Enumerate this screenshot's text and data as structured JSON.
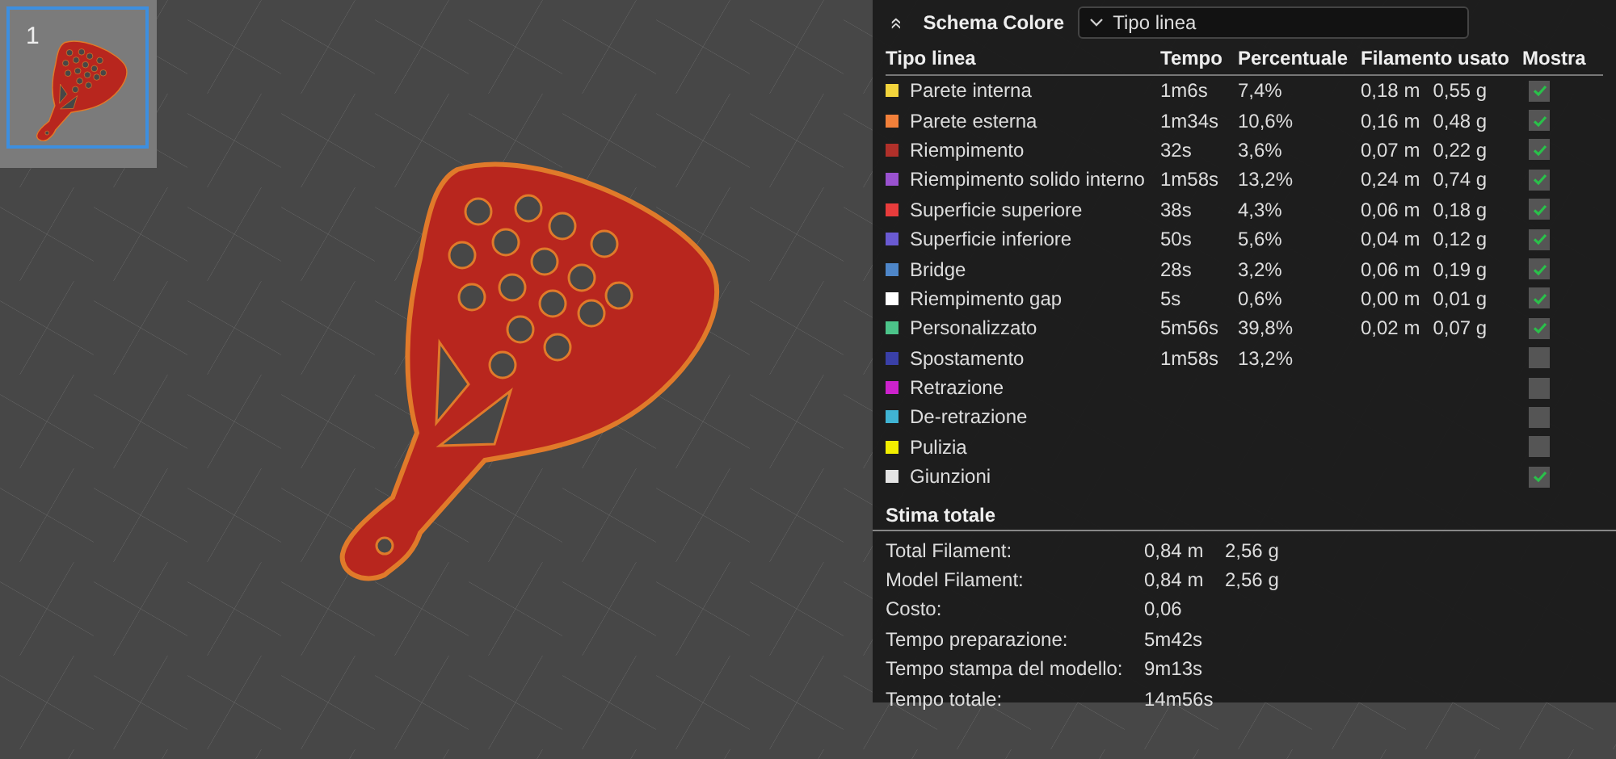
{
  "plates": [
    {
      "number": "1",
      "selected": true
    }
  ],
  "legend": {
    "title": "Schema Colore",
    "collapse_icon": "«",
    "scheme_dropdown": {
      "value": "Tipo linea"
    },
    "columns": [
      "Tipo linea",
      "Tempo",
      "Percentuale",
      "Filamento usato",
      "Mostra"
    ],
    "rows": [
      {
        "name": "Parete interna",
        "color": "#f2d43c",
        "time": "1m6s",
        "percent": "7,4%",
        "length": "0,18 m",
        "weight": "0,55 g",
        "checked": true
      },
      {
        "name": "Parete esterna",
        "color": "#f2803a",
        "time": "1m34s",
        "percent": "10,6%",
        "length": "0,16 m",
        "weight": "0,48 g",
        "checked": true
      },
      {
        "name": "Riempimento",
        "color": "#b0302a",
        "time": "32s",
        "percent": "3,6%",
        "length": "0,07 m",
        "weight": "0,22 g",
        "checked": true
      },
      {
        "name": "Riempimento solido interno",
        "color": "#9a52d0",
        "time": "1m58s",
        "percent": "13,2%",
        "length": "0,24 m",
        "weight": "0,74 g",
        "checked": true
      },
      {
        "name": "Superficie superiore",
        "color": "#e83c3c",
        "time": "38s",
        "percent": "4,3%",
        "length": "0,06 m",
        "weight": "0,18 g",
        "checked": true
      },
      {
        "name": "Superficie inferiore",
        "color": "#6a5ad2",
        "time": "50s",
        "percent": "5,6%",
        "length": "0,04 m",
        "weight": "0,12 g",
        "checked": true
      },
      {
        "name": "Bridge",
        "color": "#4e86c8",
        "time": "28s",
        "percent": "3,2%",
        "length": "0,06 m",
        "weight": "0,19 g",
        "checked": true
      },
      {
        "name": "Riempimento gap",
        "color": "#ffffff",
        "time": "5s",
        "percent": "0,6%",
        "length": "0,00 m",
        "weight": "0,01 g",
        "checked": true
      },
      {
        "name": "Personalizzato",
        "color": "#4cc48a",
        "time": "5m56s",
        "percent": "39,8%",
        "length": "0,02 m",
        "weight": "0,07 g",
        "checked": true
      },
      {
        "name": "Spostamento",
        "color": "#3a40a8",
        "time": "1m58s",
        "percent": "13,2%",
        "checked": false
      },
      {
        "name": "Retrazione",
        "color": "#cc22cc",
        "checked": false
      },
      {
        "name": "De-retrazione",
        "color": "#40b4d4",
        "checked": false
      },
      {
        "name": "Pulizia",
        "color": "#f2ee00",
        "checked": false
      },
      {
        "name": "Giunzioni",
        "color": "#e4e4e4",
        "checked": true
      }
    ]
  },
  "estimate": {
    "title": "Stima totale",
    "rows": [
      {
        "label": "Total Filament:",
        "value": "0,84 m",
        "value_2": "2,56 g"
      },
      {
        "label": "Model Filament:",
        "value": "0,84 m",
        "value_2": "2,56 g"
      },
      {
        "label": "Costo:",
        "value": "0,06"
      },
      {
        "label": "Tempo preparazione:",
        "value": "5m42s"
      },
      {
        "label": "Tempo stampa del modello:",
        "value": "9m13s"
      },
      {
        "label": "Tempo totale:",
        "value": "14m56s"
      }
    ]
  }
}
